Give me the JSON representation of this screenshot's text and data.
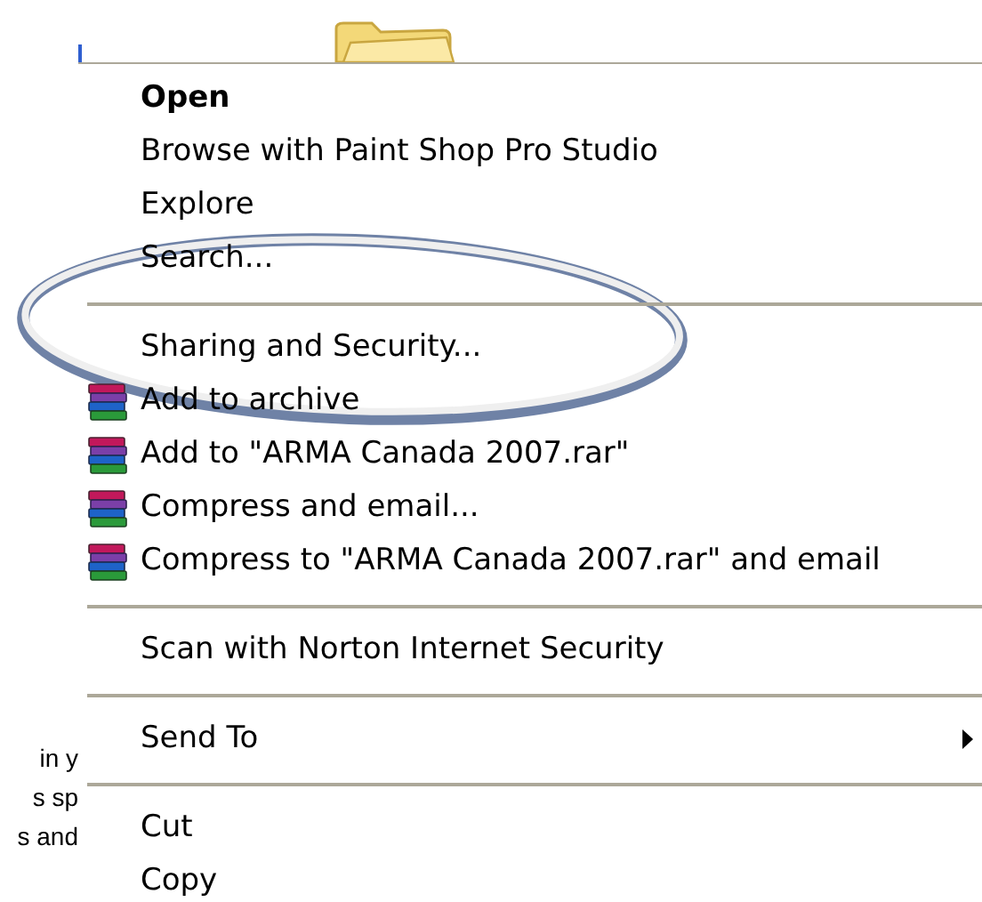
{
  "background_text": [
    "in y",
    "s sp",
    "s and"
  ],
  "context_menu": {
    "items": [
      {
        "kind": "item",
        "label": "Open",
        "default": true,
        "submenu": false
      },
      {
        "kind": "item",
        "label": "Browse with Paint Shop Pro Studio",
        "default": false,
        "submenu": false
      },
      {
        "kind": "item",
        "label": "Explore",
        "default": false,
        "submenu": false
      },
      {
        "kind": "item",
        "label": "Search...",
        "default": false,
        "submenu": false
      },
      {
        "kind": "separator"
      },
      {
        "kind": "item",
        "label": "Sharing and Security...",
        "default": false,
        "submenu": false
      },
      {
        "kind": "archive_item",
        "label": "Add to archive",
        "default": false,
        "submenu": false
      },
      {
        "kind": "archive_item",
        "label": "Add to \"ARMA Canada 2007.rar\"",
        "default": false,
        "submenu": false
      },
      {
        "kind": "archive_item",
        "label": "Compress and email...",
        "default": false,
        "submenu": false
      },
      {
        "kind": "archive_item",
        "label": "Compress to \"ARMA Canada 2007.rar\" and email",
        "default": false,
        "submenu": false
      },
      {
        "kind": "separator"
      },
      {
        "kind": "item",
        "label": "Scan with Norton Internet Security",
        "default": false,
        "submenu": false
      },
      {
        "kind": "separator"
      },
      {
        "kind": "item",
        "label": "Send To",
        "default": false,
        "submenu": true
      },
      {
        "kind": "separator"
      },
      {
        "kind": "item",
        "label": "Cut",
        "default": false,
        "submenu": false
      },
      {
        "kind": "item",
        "label": "Copy",
        "default": false,
        "submenu": false
      }
    ]
  }
}
